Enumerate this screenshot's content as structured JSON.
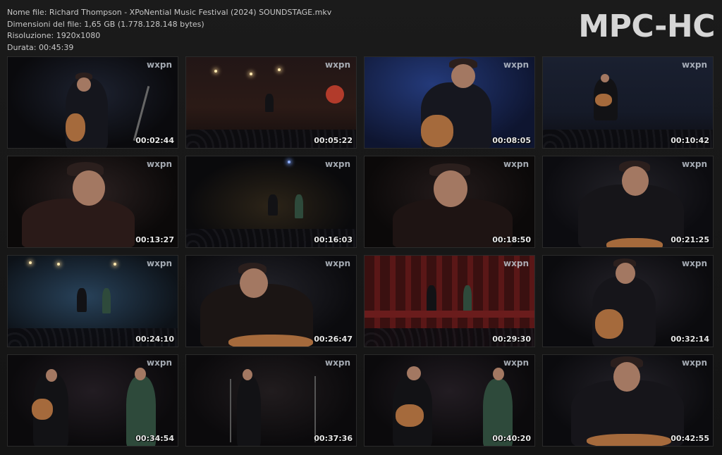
{
  "info": {
    "filename": "Nome file: Richard Thompson - XPoNential Music Festival (2024) SOUNDSTAGE.mkv",
    "filesize": "Dimensioni del file: 1,65 GB (1.778.128.148 bytes)",
    "resolution": "Risoluzione: 1920x1080",
    "duration": "Durata: 00:45:39"
  },
  "brand": "MPC-HC",
  "thumbnails": [
    {
      "logo": "wxpn",
      "time": "00:02:44"
    },
    {
      "logo": "wxpn",
      "time": "00:05:22"
    },
    {
      "logo": "wxpn",
      "time": "00:08:05"
    },
    {
      "logo": "wxpn",
      "time": "00:10:42"
    },
    {
      "logo": "wxpn",
      "time": "00:13:27"
    },
    {
      "logo": "wxpn",
      "time": "00:16:03"
    },
    {
      "logo": "wxpn",
      "time": "00:18:50"
    },
    {
      "logo": "wxpn",
      "time": "00:21:25"
    },
    {
      "logo": "wxpn",
      "time": "00:24:10"
    },
    {
      "logo": "wxpn",
      "time": "00:26:47"
    },
    {
      "logo": "wxpn",
      "time": "00:29:30"
    },
    {
      "logo": "wxpn",
      "time": "00:32:14"
    },
    {
      "logo": "wxpn",
      "time": "00:34:54"
    },
    {
      "logo": "wxpn",
      "time": "00:37:36"
    },
    {
      "logo": "wxpn",
      "time": "00:40:20"
    },
    {
      "logo": "wxpn",
      "time": "00:42:55"
    }
  ]
}
